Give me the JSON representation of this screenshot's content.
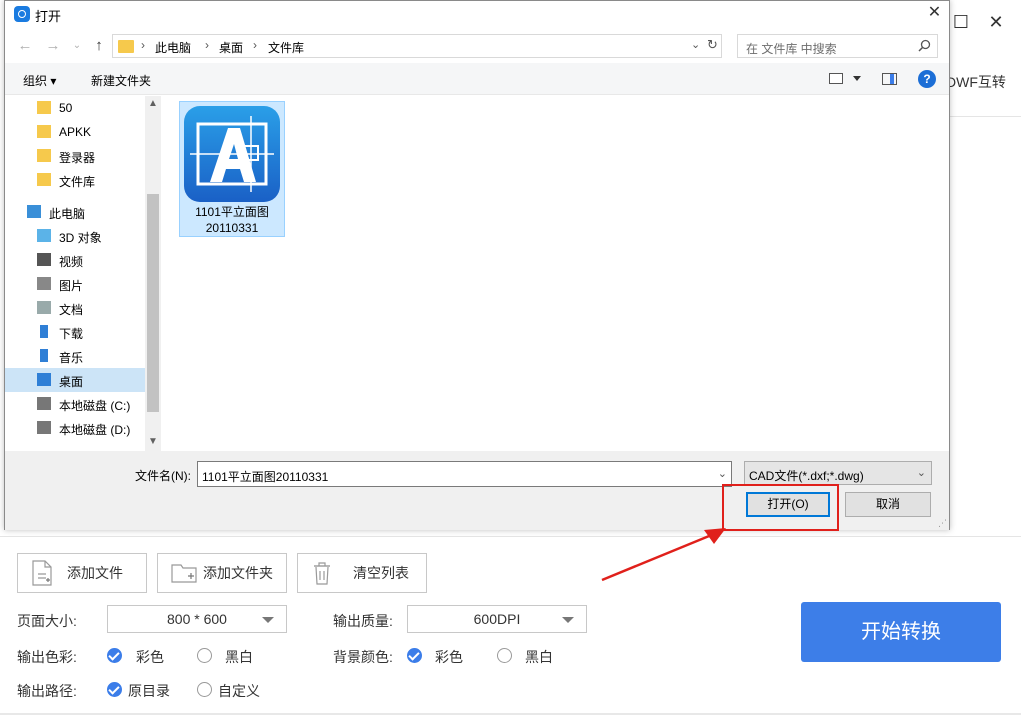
{
  "dialog": {
    "title": "打开",
    "close_glyph": "✕",
    "breadcrumb": [
      "此电脑",
      "桌面",
      "文件库"
    ],
    "search_placeholder": "在 文件库 中搜索",
    "toolbar": {
      "organize": "组织 ▾",
      "new_folder": "新建文件夹"
    },
    "help_glyph": "?",
    "nav_tree": [
      {
        "label": "50",
        "icon": "folder-icon"
      },
      {
        "label": "APKK",
        "icon": "folder-icon"
      },
      {
        "label": "登录器",
        "icon": "folder-icon"
      },
      {
        "label": "文件库",
        "icon": "folder-icon"
      },
      {
        "label": "此电脑",
        "icon": "computer-icon"
      },
      {
        "label": "3D 对象",
        "icon": "3d-objects-icon"
      },
      {
        "label": "视频",
        "icon": "video-icon"
      },
      {
        "label": "图片",
        "icon": "pictures-icon"
      },
      {
        "label": "文档",
        "icon": "documents-icon"
      },
      {
        "label": "下载",
        "icon": "download-icon"
      },
      {
        "label": "音乐",
        "icon": "music-icon"
      },
      {
        "label": "桌面",
        "icon": "desktop-icon",
        "selected": true
      },
      {
        "label": "本地磁盘 (C:)",
        "icon": "drive-c-icon"
      },
      {
        "label": "本地磁盘 (D:)",
        "icon": "drive-d-icon"
      }
    ],
    "file": {
      "name_line1": "1101平立面图",
      "name_line2": "20110331",
      "icon": "cad-file-icon"
    },
    "filename_label": "文件名(N):",
    "filename_value": "1101平立面图20110331",
    "filter_value": "CAD文件(*.dxf;*.dwg)",
    "open_label": "打开(O)",
    "cancel_label": "取消"
  },
  "app": {
    "tab_text": "DWF互转",
    "buttons": {
      "add_file": "添加文件",
      "add_folder": "添加文件夹",
      "clear_list": "清空列表"
    },
    "page_size_label": "页面大小:",
    "page_size_value": "800 * 600",
    "output_quality_label": "输出质量:",
    "output_quality_value": "600DPI",
    "output_color_label": "输出色彩:",
    "color_option": "彩色",
    "bw_option": "黑白",
    "bg_color_label": "背景颜色:",
    "output_path_label": "输出路径:",
    "original_dir": "原目录",
    "custom": "自定义",
    "start_button": "开始转换"
  },
  "colors": {
    "accent": "#3d7ee8",
    "annotation": "#e0201b",
    "selection": "#cce8ff"
  }
}
